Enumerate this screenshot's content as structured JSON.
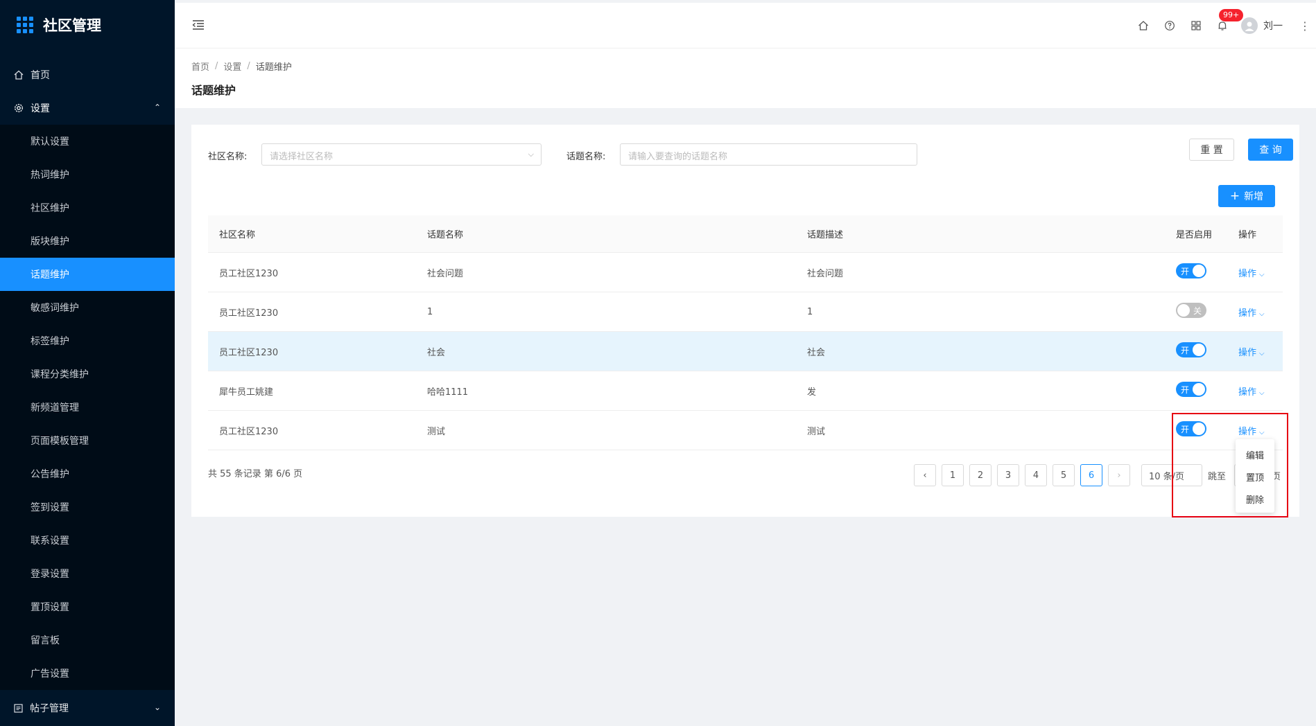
{
  "app": {
    "title": "社区管理"
  },
  "sidebar": {
    "home": "首页",
    "settings": "设置",
    "items": [
      "默认设置",
      "热词维护",
      "社区维护",
      "版块维护",
      "话题维护",
      "敏感词维护",
      "标签维护",
      "课程分类维护",
      "新频道管理",
      "页面模板管理",
      "公告维护",
      "签到设置",
      "联系设置",
      "登录设置",
      "置顶设置",
      "留言板",
      "广告设置"
    ],
    "active_index": 4,
    "posts": "帖子管理"
  },
  "header": {
    "badge": "99+",
    "user": "刘一"
  },
  "breadcrumb": {
    "home": "首页",
    "settings": "设置",
    "current": "话题维护"
  },
  "page_title": "话题维护",
  "search": {
    "community_label": "社区名称:",
    "community_placeholder": "请选择社区名称",
    "topic_label": "话题名称:",
    "topic_placeholder": "请输入要查询的话题名称",
    "reset": "重 置",
    "query": "查 询",
    "add": "新增"
  },
  "table": {
    "headers": [
      "社区名称",
      "话题名称",
      "话题描述",
      "是否启用",
      "操作"
    ],
    "rows": [
      {
        "community": "员工社区1230",
        "topic": "社会问题",
        "desc": "社会问题",
        "enabled": true,
        "switch_text": "开",
        "op": "操作"
      },
      {
        "community": "员工社区1230",
        "topic": "1",
        "desc": "1",
        "enabled": false,
        "switch_text": "关",
        "op": "操作"
      },
      {
        "community": "员工社区1230",
        "topic": "社会",
        "desc": "社会",
        "enabled": true,
        "switch_text": "开",
        "op": "操作"
      },
      {
        "community": "犀牛员工姚建",
        "topic": "哈哈1111",
        "desc": "发",
        "enabled": true,
        "switch_text": "开",
        "op": "操作"
      },
      {
        "community": "员工社区1230",
        "topic": "测试",
        "desc": "测试",
        "enabled": true,
        "switch_text": "开",
        "op": "操作"
      }
    ]
  },
  "pagination": {
    "total_text": "共 55 条记录 第 6/6 页",
    "pages": [
      "1",
      "2",
      "3",
      "4",
      "5",
      "6"
    ],
    "current": "6",
    "page_size": "10 条/页",
    "jump_label": "跳至",
    "page_suffix": "页"
  },
  "dropdown": [
    "编辑",
    "置顶",
    "删除"
  ],
  "colors": {
    "sidebar_bg": "#001529",
    "accent": "#1890ff",
    "highlight": "#e60012"
  }
}
